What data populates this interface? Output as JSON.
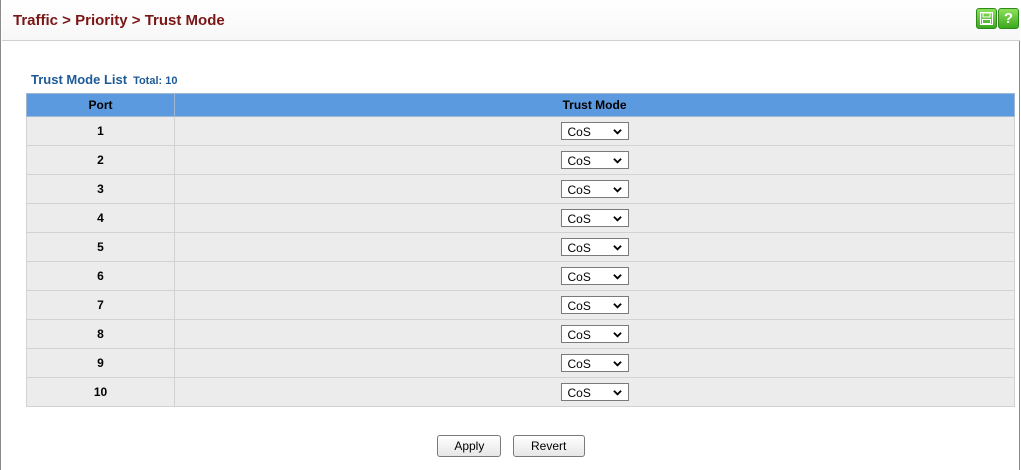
{
  "header": {
    "breadcrumb": "Traffic > Priority > Trust Mode",
    "save_icon": "save-icon",
    "help_icon": "help-icon",
    "help_glyph": "?"
  },
  "list": {
    "title": "Trust Mode List",
    "total": "Total: 10"
  },
  "table": {
    "columns": [
      "Port",
      "Trust Mode"
    ],
    "rows": [
      {
        "port": "1",
        "trust_mode": "CoS"
      },
      {
        "port": "2",
        "trust_mode": "CoS"
      },
      {
        "port": "3",
        "trust_mode": "CoS"
      },
      {
        "port": "4",
        "trust_mode": "CoS"
      },
      {
        "port": "5",
        "trust_mode": "CoS"
      },
      {
        "port": "6",
        "trust_mode": "CoS"
      },
      {
        "port": "7",
        "trust_mode": "CoS"
      },
      {
        "port": "8",
        "trust_mode": "CoS"
      },
      {
        "port": "9",
        "trust_mode": "CoS"
      },
      {
        "port": "10",
        "trust_mode": "CoS"
      }
    ]
  },
  "buttons": {
    "apply": "Apply",
    "revert": "Revert"
  },
  "colors": {
    "breadcrumb": "#7a1616",
    "list_title": "#1d5a96",
    "table_header": "#5c9ae0",
    "row_bg": "#ececec",
    "icon_green": "#3aa81e"
  }
}
